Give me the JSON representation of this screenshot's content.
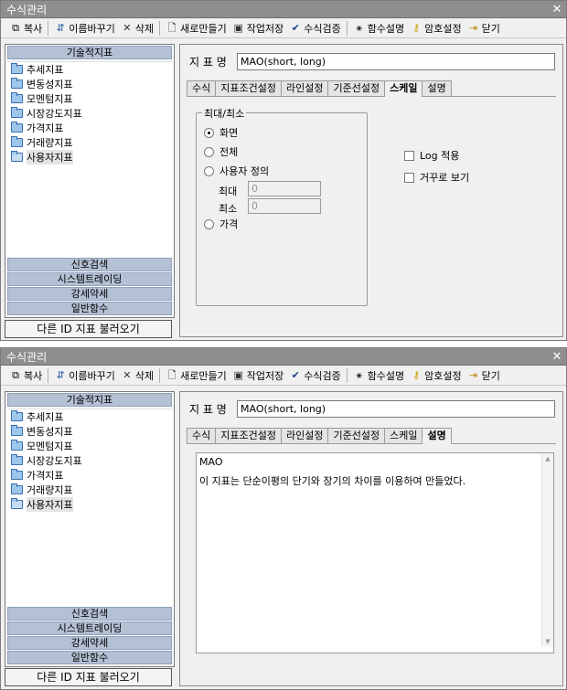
{
  "window_title": "수식관리",
  "toolbar": {
    "copy": "복사",
    "rename": "이름바꾸기",
    "delete": "삭제",
    "new": "새로만들기",
    "save": "작업저장",
    "verify": "수식검증",
    "func_help": "함수설명",
    "password": "암호설정",
    "close": "닫기"
  },
  "left": {
    "category_header": "기술적지표",
    "tree": [
      "추세지표",
      "변동성지표",
      "모멘텀지표",
      "시장강도지표",
      "가격지표",
      "거래량지표",
      "사용자지표"
    ],
    "sections": [
      "신호검색",
      "시스템트레이딩",
      "강세약세",
      "일반함수"
    ],
    "load_button": "다른 ID 지표 불러오기"
  },
  "right": {
    "name_label": "지 표 명",
    "name_value": "MAO(short, long)",
    "tabs": [
      "수식",
      "지표조건설정",
      "라인설정",
      "기준선설정",
      "스케일",
      "설명"
    ]
  },
  "scale": {
    "group_label": "최대/최소",
    "radio_screen": "화면",
    "radio_all": "전체",
    "radio_user": "사용자 정의",
    "max_label": "최대",
    "max_value": "0",
    "min_label": "최소",
    "min_value": "0",
    "radio_price": "가격",
    "log_label": "Log 적용",
    "reverse_label": "거꾸로 보기"
  },
  "description": {
    "line1": "MAO",
    "line2": "이 지표는 단순이평의 단기와 장기의 차이를 이용하여 만들었다."
  }
}
